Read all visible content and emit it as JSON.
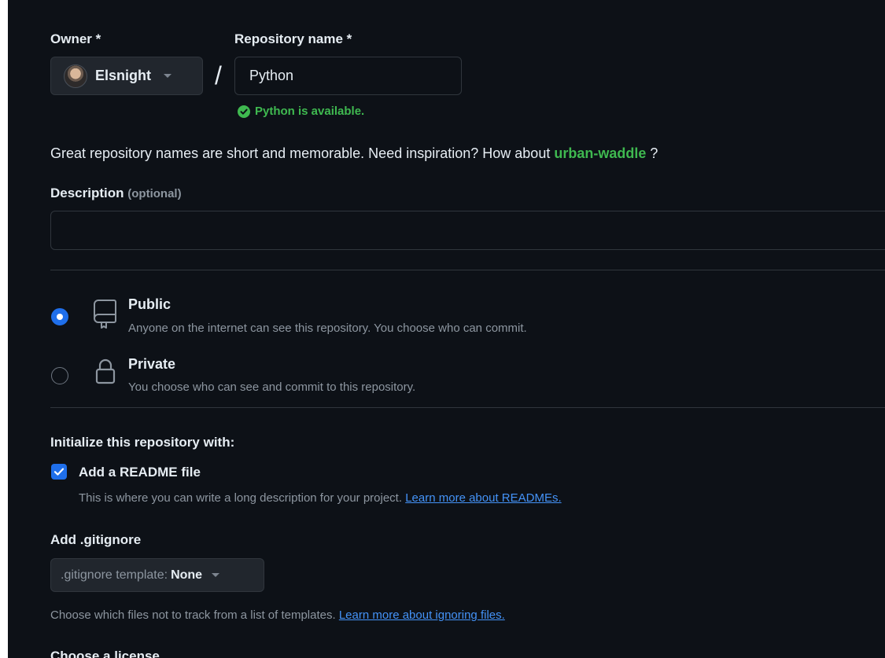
{
  "owner": {
    "label": "Owner *",
    "name": "Elsnight"
  },
  "repo": {
    "label": "Repository name *",
    "value": "Python",
    "availability": "Python is available."
  },
  "hint": {
    "prefix": "Great repository names are short and memorable. Need inspiration? How about",
    "suggestion": "urban-waddle",
    "suffix": "?"
  },
  "description": {
    "label": "Description",
    "optional": "(optional)",
    "value": "",
    "placeholder": ""
  },
  "visibility": {
    "public": {
      "title": "Public",
      "desc": "Anyone on the internet can see this repository. You choose who can commit.",
      "selected": true
    },
    "private": {
      "title": "Private",
      "desc": "You choose who can see and commit to this repository.",
      "selected": false
    }
  },
  "init": {
    "heading": "Initialize this repository with:",
    "readme": {
      "label": "Add a README file",
      "checked": true,
      "desc": "This is where you can write a long description for your project.",
      "link": "Learn more about READMEs."
    }
  },
  "gitignore": {
    "heading": "Add .gitignore",
    "select_prefix": ".gitignore template:",
    "select_value": "None",
    "desc": "Choose which files not to track from a list of templates.",
    "link": "Learn more about ignoring files."
  },
  "license": {
    "heading": "Choose a license"
  },
  "colors": {
    "background": "#0d1117",
    "accent": "#1f6feb",
    "success": "#3fb950",
    "link": "#4493f8"
  }
}
